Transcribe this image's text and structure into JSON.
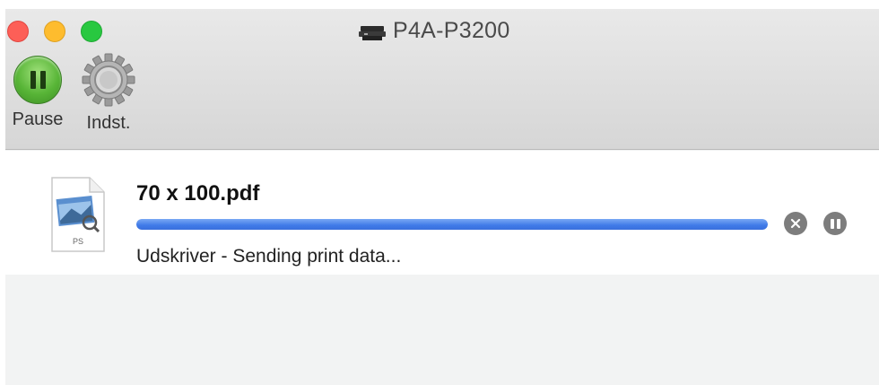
{
  "window": {
    "title": "P4A-P3200",
    "title_icon": "printer-icon"
  },
  "toolbar": {
    "pause_label": "Pause",
    "settings_label": "Indst."
  },
  "job": {
    "name": "70 x 100.pdf",
    "file_type_label": "PS",
    "status": "Udskriver - Sending print data...",
    "progress": 1.0
  },
  "colors": {
    "close": "#fd5f57",
    "minimize": "#febc2e",
    "maximize": "#28c840",
    "progress": "#3f7ae8"
  }
}
